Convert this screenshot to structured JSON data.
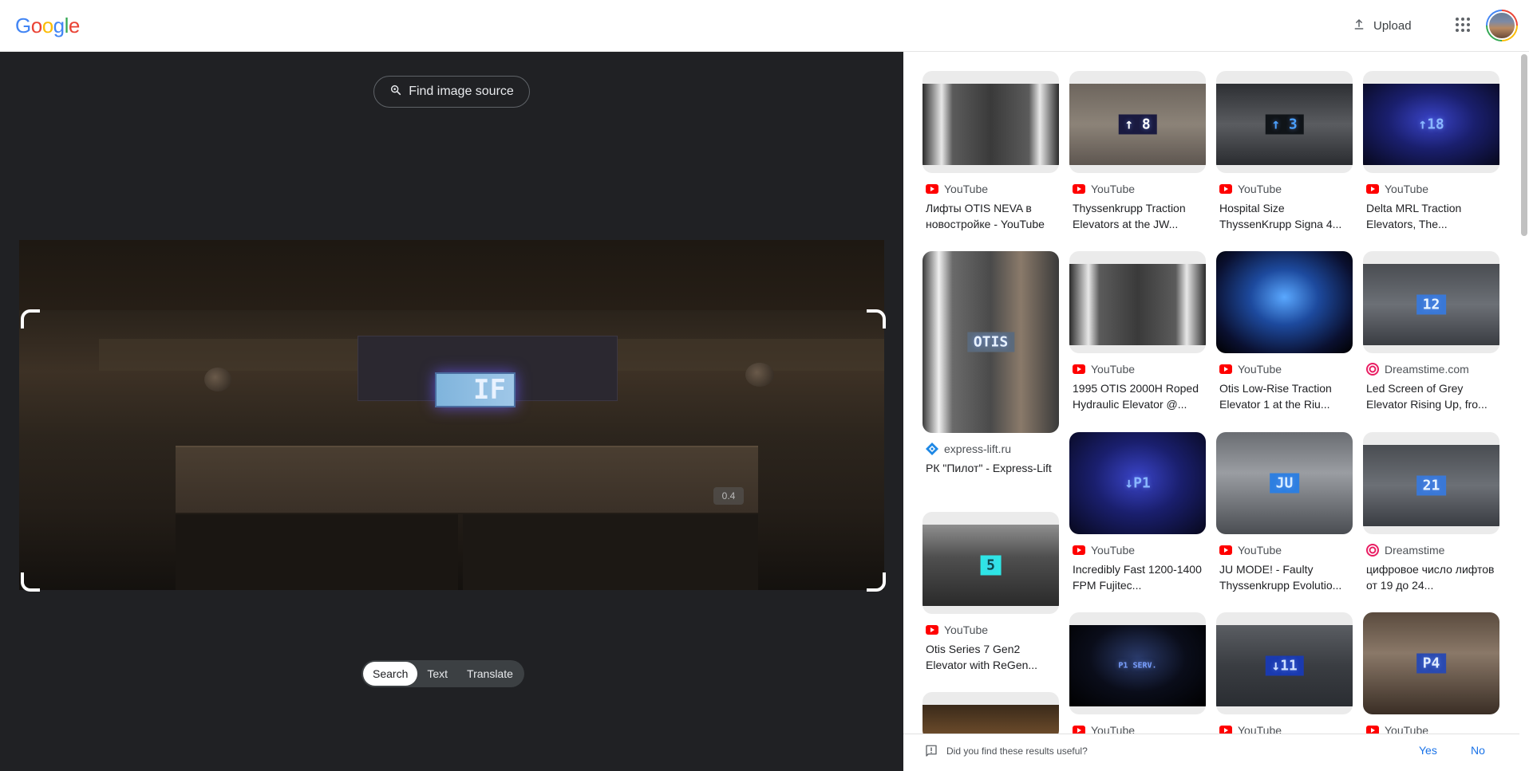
{
  "header": {
    "logo_letters": [
      "G",
      "o",
      "o",
      "g",
      "l",
      "e"
    ],
    "logo_colors": [
      "#4285f4",
      "#ea4335",
      "#fbbc04",
      "#4285f4",
      "#34a853",
      "#ea4335"
    ],
    "upload_label": "Upload"
  },
  "lens": {
    "find_source_label": "Find image source",
    "lcd_text": "IF",
    "watermark_text": "0.4",
    "modes": [
      {
        "label": "Search",
        "active": true
      },
      {
        "label": "Text",
        "active": false
      },
      {
        "label": "Translate",
        "active": false
      }
    ]
  },
  "results": [
    {
      "source": "YouTube",
      "source_icon": "youtube-icon",
      "title": "Лифты OTIS NEVA в новостройке - YouTube",
      "thumb_text": "",
      "thumb_palette": "dark-silver"
    },
    {
      "source": "YouTube",
      "source_icon": "youtube-icon",
      "title": "Thyssenkrupp Traction Elevators at the JW...",
      "thumb_text": "↑ 8",
      "thumb_palette": "steel"
    },
    {
      "source": "YouTube",
      "source_icon": "youtube-icon",
      "title": "Hospital Size ThyssenKrupp Signa 4...",
      "thumb_text": "↑ 3",
      "thumb_palette": "steel-dark"
    },
    {
      "source": "YouTube",
      "source_icon": "youtube-icon",
      "title": "Delta MRL Traction Elevators, The...",
      "thumb_text": "↑18",
      "thumb_palette": "blue-night"
    },
    {
      "source": "express-lift.ru",
      "source_icon": "express-lift-icon",
      "title": "РК \"Пилот\" - Express-Lift",
      "thumb_text": "OTIS",
      "thumb_palette": "silver-tall"
    },
    {
      "source": "YouTube",
      "source_icon": "youtube-icon",
      "title": "1995 OTIS 2000H Roped Hydraulic Elevator @...",
      "thumb_text": "",
      "thumb_palette": "dark-silver"
    },
    {
      "source": "YouTube",
      "source_icon": "youtube-icon",
      "title": "Otis Low-Rise Traction Elevator 1 at the Riu...",
      "thumb_text": "",
      "thumb_palette": "blue-glow"
    },
    {
      "source": "Dreamstime.com",
      "source_icon": "dreamstime-icon",
      "title": "Led Screen of Grey Elevator Rising Up, fro...",
      "thumb_text": "12",
      "thumb_palette": "grey-blue"
    },
    {
      "source": "YouTube",
      "source_icon": "youtube-icon",
      "title": "Otis Series 7 Gen2 Elevator with ReGen...",
      "thumb_text": "5",
      "thumb_palette": "cyan-panel"
    },
    {
      "source": "YouTube",
      "source_icon": "youtube-icon",
      "title": "Incredibly Fast 1200-1400 FPM Fujitec...",
      "thumb_text": "↓P1",
      "thumb_palette": "blue-night"
    },
    {
      "source": "YouTube",
      "source_icon": "youtube-icon",
      "title": "JU MODE! - Faulty Thyssenkrupp Evolutio...",
      "thumb_text": "JU",
      "thumb_palette": "steel-blue"
    },
    {
      "source": "Dreamstime",
      "source_icon": "dreamstime-icon",
      "title": "цифровое число лифтов от 19 до 24...",
      "thumb_text": "21",
      "thumb_palette": "grey-blue"
    },
    {
      "source": "",
      "source_icon": "",
      "title": "",
      "thumb_text": "",
      "thumb_palette": "warm-dark"
    },
    {
      "source": "YouTube",
      "source_icon": "youtube-icon",
      "title": "",
      "thumb_text": "P1 SERV.",
      "thumb_palette": "black"
    },
    {
      "source": "YouTube",
      "source_icon": "youtube-icon",
      "title": "",
      "thumb_text": "↓11",
      "thumb_palette": "blue-steel"
    },
    {
      "source": "YouTube",
      "source_icon": "youtube-icon",
      "title": "",
      "thumb_text": "P4",
      "thumb_palette": "brown-steel"
    }
  ],
  "feedback": {
    "question": "Did you find these results useful?",
    "yes": "Yes",
    "no": "No"
  }
}
